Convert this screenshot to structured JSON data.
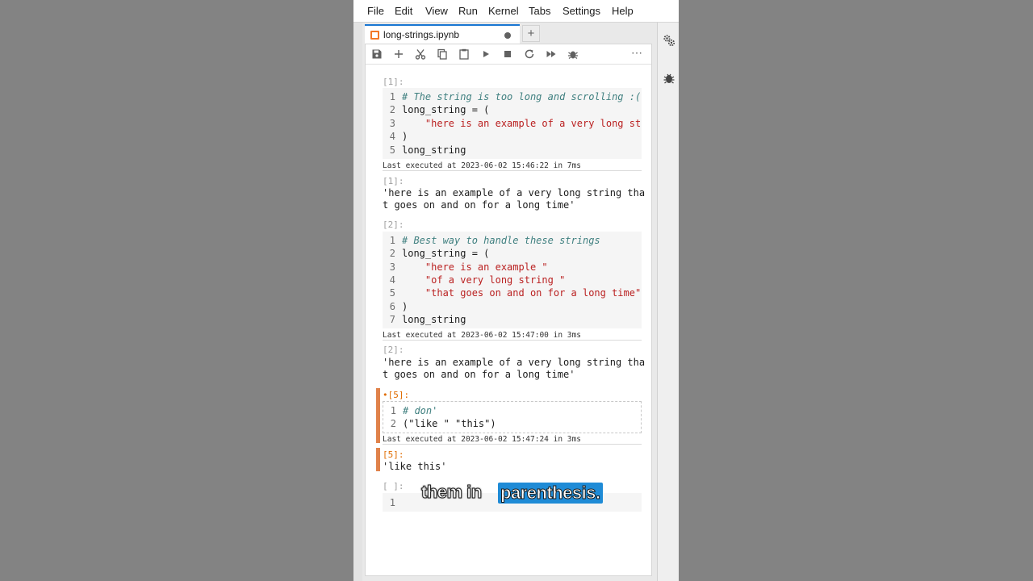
{
  "menu": [
    "File",
    "Edit",
    "View",
    "Run",
    "Kernel",
    "Tabs",
    "Settings",
    "Help"
  ],
  "tab": {
    "label": "long-strings.ipynb",
    "add": "+"
  },
  "toolbar": {
    "more": "⋯"
  },
  "icons": {
    "save": "save-icon",
    "add": "add-cell-icon",
    "cut": "cut-icon",
    "copy": "copy-icon",
    "paste": "paste-icon",
    "run": "run-icon",
    "stop": "stop-icon",
    "restart": "restart-icon",
    "run_all": "fast-forward-icon",
    "debug": "bug-icon",
    "settings": "gears-icon"
  },
  "cells": [
    {
      "prompt": "[1]:",
      "lines": [
        {
          "n": "1",
          "text": "# The string is too long and scrolling :("
        },
        {
          "n": "2",
          "text": "long_string = ("
        },
        {
          "n": "3",
          "text": "    \"here is an example of a very long str:"
        },
        {
          "n": "4",
          "text": ")"
        },
        {
          "n": "5",
          "text": "long_string"
        }
      ],
      "meta": "Last executed at 2023-06-02 15:46:22 in 7ms",
      "out_prompt": "[1]:",
      "output": "'here is an example of a very long string tha\nt goes on and on for a long time'"
    },
    {
      "prompt": "[2]:",
      "lines": [
        {
          "n": "1",
          "text": "# Best way to handle these strings"
        },
        {
          "n": "2",
          "text": "long_string = ("
        },
        {
          "n": "3",
          "text": "    \"here is an example \""
        },
        {
          "n": "4",
          "text": "    \"of a very long string \""
        },
        {
          "n": "5",
          "text": "    \"that goes on and on for a long time\""
        },
        {
          "n": "6",
          "text": ")"
        },
        {
          "n": "7",
          "text": "long_string"
        }
      ],
      "meta": "Last executed at 2023-06-02 15:47:00 in 3ms",
      "out_prompt": "[2]:",
      "output": "'here is an example of a very long string tha\nt goes on and on for a long time'"
    },
    {
      "prompt": "•[5]:",
      "lines": [
        {
          "n": "1",
          "text": "# don'"
        },
        {
          "n": "2",
          "text": "(\"like \" \"this\")"
        }
      ],
      "meta": "Last executed at 2023-06-02 15:47:24 in 3ms",
      "out_prompt": "[5]:",
      "output": "'like this'"
    },
    {
      "prompt": "[ ]:",
      "lines": [
        {
          "n": "1",
          "text": ""
        }
      ]
    }
  ],
  "caption": {
    "plain": "them in",
    "highlight": "parenthesis."
  }
}
